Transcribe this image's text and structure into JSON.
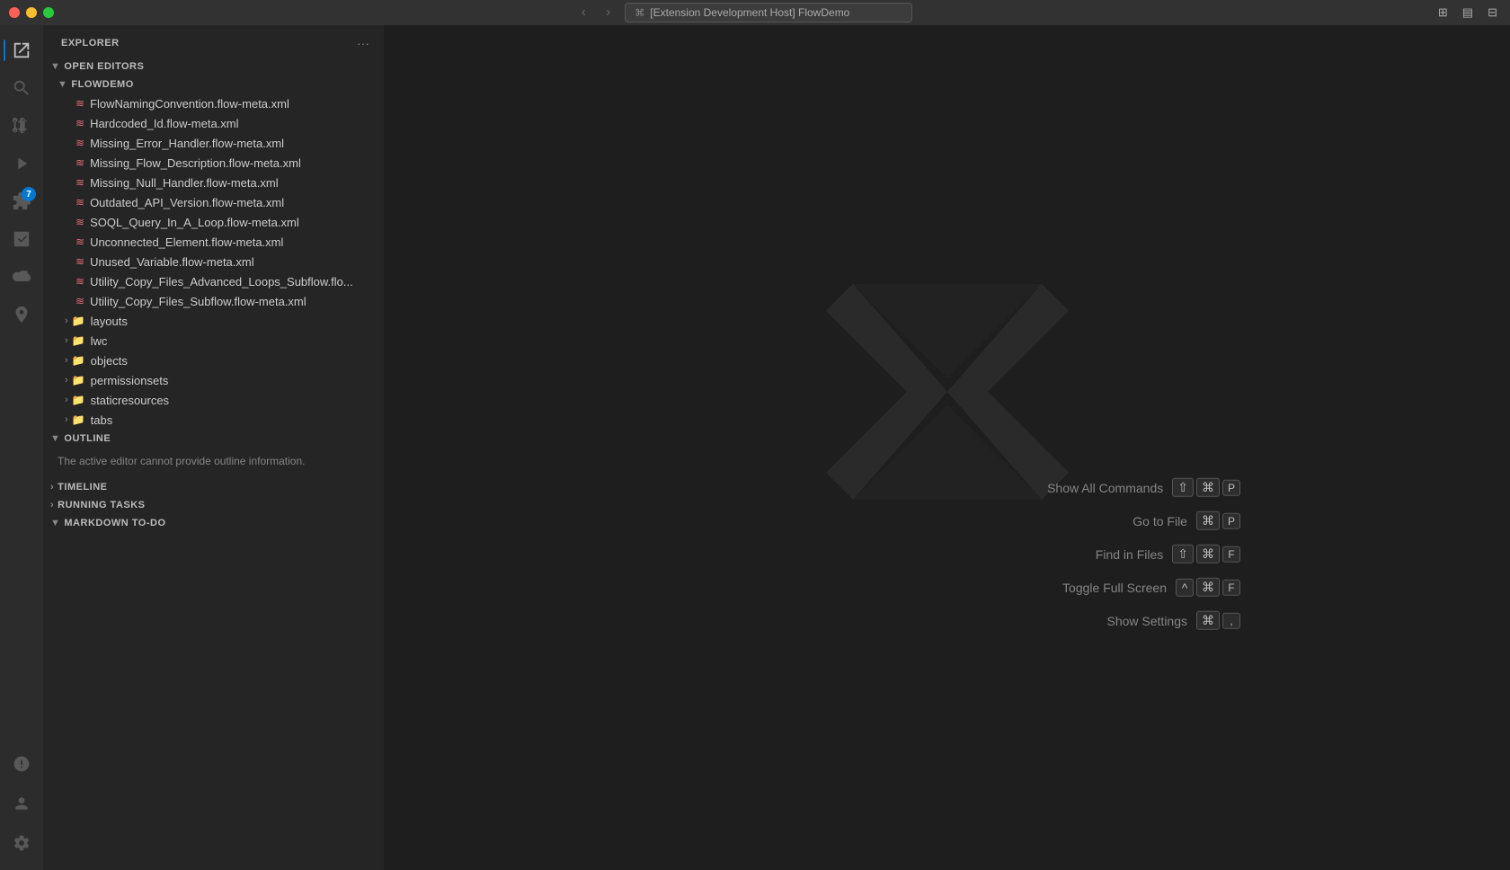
{
  "titlebar": {
    "title": "[Extension Development Host] FlowDemo",
    "nav_back": "‹",
    "nav_forward": "›"
  },
  "activity": {
    "icons": [
      {
        "name": "explorer-icon",
        "symbol": "⎘",
        "active": true,
        "badge": null
      },
      {
        "name": "search-icon",
        "symbol": "🔍",
        "active": false,
        "badge": null
      },
      {
        "name": "source-control-icon",
        "symbol": "⎇",
        "active": false,
        "badge": null
      },
      {
        "name": "run-icon",
        "symbol": "▶",
        "active": false,
        "badge": null
      },
      {
        "name": "extensions-icon",
        "symbol": "⊞",
        "active": false,
        "badge": "7"
      },
      {
        "name": "test-icon",
        "symbol": "⚗",
        "active": false,
        "badge": null
      },
      {
        "name": "salesforce-icon",
        "symbol": "☁",
        "active": false,
        "badge": null
      },
      {
        "name": "org-icon",
        "symbol": "🏢",
        "active": false,
        "badge": null
      }
    ],
    "bottom_icons": [
      {
        "name": "problems-icon",
        "symbol": "⚠",
        "active": false
      },
      {
        "name": "account-icon",
        "symbol": "👤",
        "active": false
      },
      {
        "name": "settings-icon",
        "symbol": "⚙",
        "active": false
      }
    ]
  },
  "sidebar": {
    "title": "Explorer",
    "more_actions": "···",
    "sections": {
      "open_editors": {
        "label": "Open Editors",
        "expanded": true
      },
      "flowdemo": {
        "label": "FlowDemo",
        "expanded": true,
        "files": [
          "FlowNamingConvention.flow-meta.xml",
          "Hardcoded_Id.flow-meta.xml",
          "Missing_Error_Handler.flow-meta.xml",
          "Missing_Flow_Description.flow-meta.xml",
          "Missing_Null_Handler.flow-meta.xml",
          "Outdated_API_Version.flow-meta.xml",
          "SOQL_Query_In_A_Loop.flow-meta.xml",
          "Unconnected_Element.flow-meta.xml",
          "Unused_Variable.flow-meta.xml",
          "Utility_Copy_Files_Advanced_Loops_Subflow.flo...",
          "Utility_Copy_Files_Subflow.flow-meta.xml"
        ],
        "folders": [
          "layouts",
          "lwc",
          "objects",
          "permissionsets",
          "staticresources",
          "tabs"
        ]
      },
      "outline": {
        "label": "Outline",
        "expanded": true,
        "message": "The active editor cannot provide outline information."
      },
      "timeline": {
        "label": "Timeline",
        "expanded": false
      },
      "running_tasks": {
        "label": "Running Tasks",
        "expanded": false
      },
      "markdown_todo": {
        "label": "Markdown To-Do",
        "expanded": true
      }
    }
  },
  "command_hints": [
    {
      "label": "Show All Commands",
      "keys": [
        "⇧",
        "⌘",
        "P"
      ]
    },
    {
      "label": "Go to File",
      "keys": [
        "⌘",
        "P"
      ]
    },
    {
      "label": "Find in Files",
      "keys": [
        "⇧",
        "⌘",
        "F"
      ]
    },
    {
      "label": "Toggle Full Screen",
      "keys": [
        "^",
        "⌘",
        "F"
      ]
    },
    {
      "label": "Show Settings",
      "keys": [
        "⌘",
        ","
      ]
    }
  ]
}
